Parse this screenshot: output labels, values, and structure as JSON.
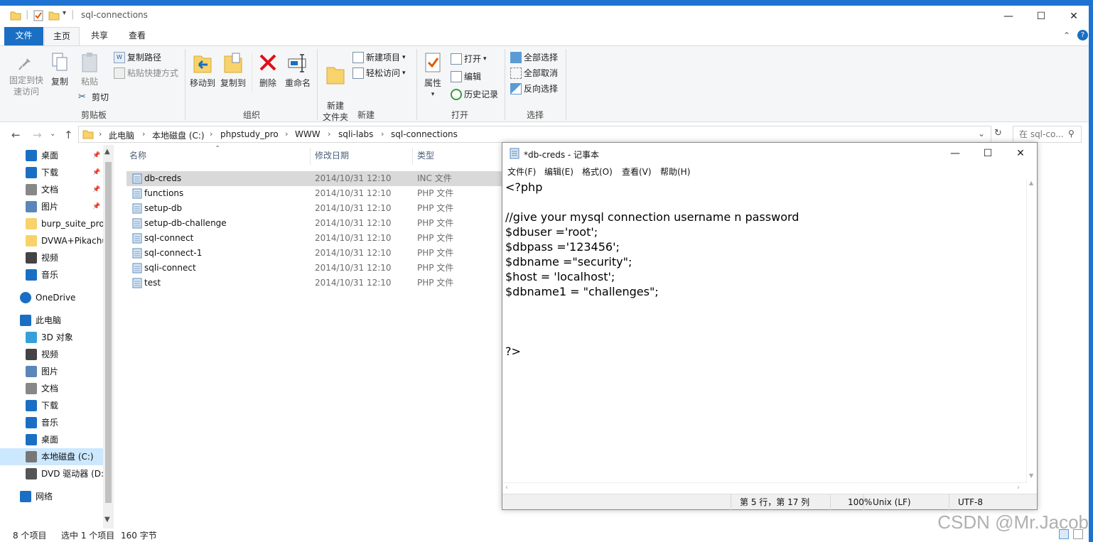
{
  "explorer": {
    "title": "sql-connections",
    "tabs": [
      "文件",
      "主页",
      "共享",
      "查看"
    ],
    "ribbon": {
      "clipboard": {
        "pin_label": "固定到快速访问",
        "copy_label": "复制",
        "paste_label": "粘贴",
        "copy_path_label": "复制路径",
        "paste_shortcut_label": "粘贴快捷方式",
        "cut_label": "剪切",
        "group_label": "剪贴板"
      },
      "organize": {
        "move_to_label": "移动到",
        "copy_to_label": "复制到",
        "delete_label": "删除",
        "rename_label": "重命名",
        "group_label": "组织"
      },
      "new": {
        "new_folder_label": "新建\n文件夹",
        "new_item_label": "新建项目",
        "easy_access_label": "轻松访问",
        "group_label": "新建"
      },
      "open": {
        "properties_label": "属性",
        "open_label": "打开",
        "edit_label": "编辑",
        "history_label": "历史记录",
        "group_label": "打开"
      },
      "select": {
        "select_all_label": "全部选择",
        "select_none_label": "全部取消",
        "invert_label": "反向选择",
        "group_label": "选择"
      }
    },
    "breadcrumb": [
      "此电脑",
      "本地磁盘 (C:)",
      "phpstudy_pro",
      "WWW",
      "sqli-labs",
      "sql-connections"
    ],
    "search_placeholder": "在 sql-co...",
    "nav": [
      {
        "label": "桌面",
        "icon": "desktop-icon",
        "pinned": true
      },
      {
        "label": "下载",
        "icon": "download-icon",
        "pinned": true
      },
      {
        "label": "文档",
        "icon": "document-icon",
        "pinned": true
      },
      {
        "label": "图片",
        "icon": "pictures-icon",
        "pinned": true
      },
      {
        "label": "burp_suite_pro",
        "icon": "folder-icon",
        "pinned": false
      },
      {
        "label": "DVWA+Pikachu",
        "icon": "folder-icon",
        "pinned": false
      },
      {
        "label": "视频",
        "icon": "video-icon",
        "pinned": false
      },
      {
        "label": "音乐",
        "icon": "music-icon",
        "pinned": false
      },
      {
        "label": "OneDrive",
        "icon": "onedrive-icon",
        "pinned": false
      },
      {
        "label": "此电脑",
        "icon": "computer-icon",
        "pinned": false
      },
      {
        "label": "3D 对象",
        "icon": "3d-objects-icon",
        "pinned": false
      },
      {
        "label": "视频",
        "icon": "video-icon",
        "pinned": false
      },
      {
        "label": "图片",
        "icon": "pictures-icon",
        "pinned": false
      },
      {
        "label": "文档",
        "icon": "document-icon",
        "pinned": false
      },
      {
        "label": "下载",
        "icon": "download-icon",
        "pinned": false
      },
      {
        "label": "音乐",
        "icon": "music-icon",
        "pinned": false
      },
      {
        "label": "桌面",
        "icon": "desktop-icon",
        "pinned": false
      },
      {
        "label": "本地磁盘 (C:)",
        "icon": "drive-icon",
        "pinned": false
      },
      {
        "label": "DVD 驱动器 (D:",
        "icon": "dvd-icon",
        "pinned": false
      },
      {
        "label": "网络",
        "icon": "network-icon",
        "pinned": false
      }
    ],
    "columns": {
      "name": "名称",
      "date": "修改日期",
      "type": "类型"
    },
    "files": [
      {
        "name": "db-creds",
        "date": "2014/10/31 12:10",
        "type": "INC 文件"
      },
      {
        "name": "functions",
        "date": "2014/10/31 12:10",
        "type": "PHP 文件"
      },
      {
        "name": "setup-db",
        "date": "2014/10/31 12:10",
        "type": "PHP 文件"
      },
      {
        "name": "setup-db-challenge",
        "date": "2014/10/31 12:10",
        "type": "PHP 文件"
      },
      {
        "name": "sql-connect",
        "date": "2014/10/31 12:10",
        "type": "PHP 文件"
      },
      {
        "name": "sql-connect-1",
        "date": "2014/10/31 12:10",
        "type": "PHP 文件"
      },
      {
        "name": "sqli-connect",
        "date": "2014/10/31 12:10",
        "type": "PHP 文件"
      },
      {
        "name": "test",
        "date": "2014/10/31 12:10",
        "type": "PHP 文件"
      }
    ],
    "status": {
      "count": "8 个项目",
      "selected": "选中 1 个项目",
      "size": "160 字节"
    }
  },
  "notepad": {
    "title": "*db-creds - 记事本",
    "menu": [
      "文件(F)",
      "编辑(E)",
      "格式(O)",
      "查看(V)",
      "帮助(H)"
    ],
    "lines": [
      "<?php",
      "",
      "//give your mysql connection username n password",
      "$dbuser ='root';",
      "$dbpass ='123456';",
      "$dbname =\"security\";",
      "$host = 'localhost';",
      "$dbname1 = \"challenges\";",
      "",
      "",
      "",
      "?>"
    ],
    "status": {
      "position": "第 5 行，第 17 列",
      "zoom": "100%",
      "eol": "Unix (LF)",
      "encoding": "UTF-8"
    }
  },
  "watermark": "CSDN @Mr.Jacob",
  "colors": {
    "accent": "#1e73d2",
    "selected_row": "#d9d9d9",
    "nav_selected": "#cce8ff",
    "folder": "#f8d26a"
  }
}
